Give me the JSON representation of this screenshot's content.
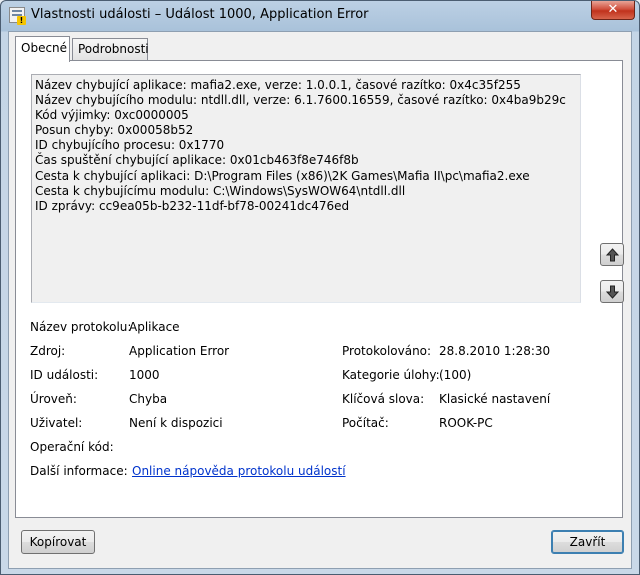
{
  "window": {
    "title": "Vlastnosti události – Událost 1000, Application Error",
    "close_label": "✕"
  },
  "tabs": [
    {
      "label": "Obecné",
      "active": true
    },
    {
      "label": "Podrobnosti",
      "active": false
    }
  ],
  "description_lines": [
    "Název chybující aplikace: mafia2.exe, verze: 1.0.0.1, časové razítko: 0x4c35f255",
    "Název chybujícího modulu: ntdll.dll, verze: 6.1.7600.16559, časové razítko: 0x4ba9b29c",
    "Kód výjimky: 0xc0000005",
    "Posun chyby: 0x00058b52",
    "ID chybujícího procesu: 0x1770",
    "Čas spuštění chybující aplikace: 0x01cb463f8e746f8b",
    "Cesta k chybující aplikaci: D:\\Program Files (x86)\\2K Games\\Mafia II\\pc\\mafia2.exe",
    "Cesta k chybujícímu modulu: C:\\Windows\\SysWOW64\\ntdll.dll",
    "ID zprávy: cc9ea05b-b232-11df-bf78-00241dc476ed"
  ],
  "nav": {
    "up_icon": "arrow-up-icon",
    "down_icon": "arrow-down-icon"
  },
  "props": {
    "log_name_label": "Název protokolu:",
    "log_name_value": "Aplikace",
    "source_label": "Zdroj:",
    "source_value": "Application Error",
    "logged_label": "Protokolováno:",
    "logged_value": "28.8.2010 1:28:30",
    "event_id_label": "ID události:",
    "event_id_value": "1000",
    "task_category_label": "Kategorie úlohy:",
    "task_category_value": "(100)",
    "level_label": "Úroveň:",
    "level_value": "Chyba",
    "keywords_label": "Klíčová slova:",
    "keywords_value": "Klasické nastavení",
    "user_label": "Uživatel:",
    "user_value": "Není k dispozici",
    "computer_label": "Počítač:",
    "computer_value": "ROOK-PC",
    "opcode_label": "Operační kód:",
    "opcode_value": "",
    "more_info_label": "Další informace:",
    "more_info_link": "Online nápověda protokolu událostí"
  },
  "buttons": {
    "copy": "Kopírovat",
    "close": "Zavřít"
  },
  "colors": {
    "link": "#0033cc",
    "close_button": "#c1321c"
  }
}
